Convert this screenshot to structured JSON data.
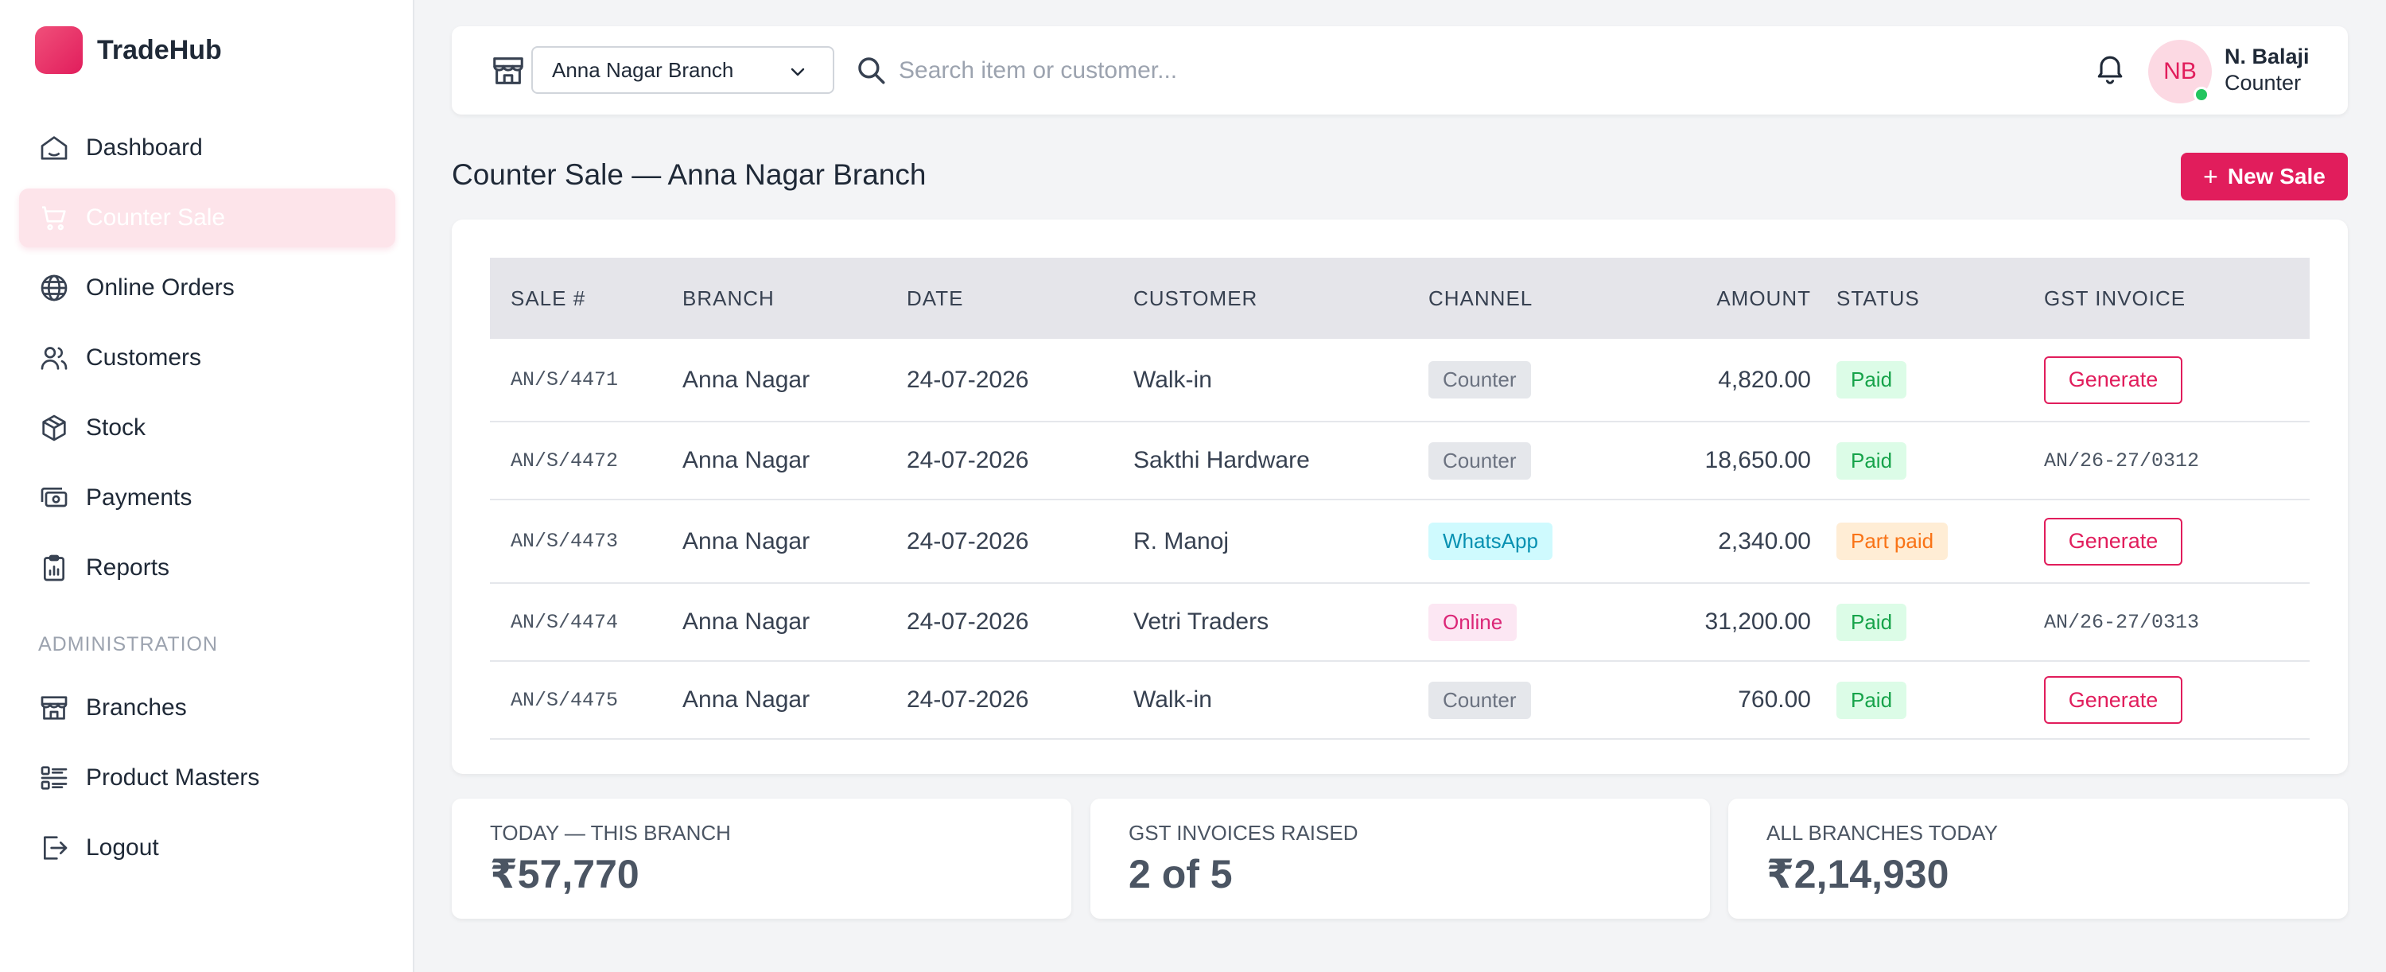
{
  "app": {
    "name": "TradeHub"
  },
  "sidebar": {
    "items": [
      {
        "label": "Dashboard",
        "icon": "home-icon"
      },
      {
        "label": "Counter Sale",
        "icon": "cart-icon",
        "active": true
      },
      {
        "label": "Online Orders",
        "icon": "globe-icon"
      },
      {
        "label": "Customers",
        "icon": "users-icon"
      },
      {
        "label": "Stock",
        "icon": "box-icon"
      },
      {
        "label": "Payments",
        "icon": "cash-icon"
      },
      {
        "label": "Reports",
        "icon": "clipboard-chart-icon"
      }
    ],
    "section_label": "ADMINISTRATION",
    "admin_items": [
      {
        "label": "Branches",
        "icon": "store-icon"
      },
      {
        "label": "Product Masters",
        "icon": "list-icon"
      },
      {
        "label": "Logout",
        "icon": "logout-icon"
      }
    ]
  },
  "topbar": {
    "branch_select": "Anna Nagar Branch",
    "search_placeholder": "Search item or customer...",
    "user": {
      "initials": "NB",
      "name": "N. Balaji",
      "role": "Counter"
    }
  },
  "page": {
    "title": "Counter Sale — Anna Nagar Branch",
    "new_sale_label": "New Sale"
  },
  "table": {
    "columns": [
      "SALE #",
      "BRANCH",
      "DATE",
      "CUSTOMER",
      "CHANNEL",
      "AMOUNT",
      "STATUS",
      "GST INVOICE"
    ],
    "rows": [
      {
        "sale": "AN/S/4471",
        "branch": "Anna Nagar",
        "date": "24-07-2026",
        "customer": "Walk-in",
        "channel": "Counter",
        "amount": "4,820.00",
        "status": "Paid",
        "invoice": "Generate"
      },
      {
        "sale": "AN/S/4472",
        "branch": "Anna Nagar",
        "date": "24-07-2026",
        "customer": "Sakthi Hardware",
        "channel": "Counter",
        "amount": "18,650.00",
        "status": "Paid",
        "invoice": "AN/26-27/0312"
      },
      {
        "sale": "AN/S/4473",
        "branch": "Anna Nagar",
        "date": "24-07-2026",
        "customer": "R. Manoj",
        "channel": "WhatsApp",
        "amount": "2,340.00",
        "status": "Part paid",
        "invoice": "Generate"
      },
      {
        "sale": "AN/S/4474",
        "branch": "Anna Nagar",
        "date": "24-07-2026",
        "customer": "Vetri Traders",
        "channel": "Online",
        "amount": "31,200.00",
        "status": "Paid",
        "invoice": "AN/26-27/0313"
      },
      {
        "sale": "AN/S/4475",
        "branch": "Anna Nagar",
        "date": "24-07-2026",
        "customer": "Walk-in",
        "channel": "Counter",
        "amount": "760.00",
        "status": "Paid",
        "invoice": "Generate"
      }
    ]
  },
  "stats": [
    {
      "label": "TODAY — THIS BRANCH",
      "value": "₹57,770"
    },
    {
      "label": "GST INVOICES RAISED",
      "value": "2 of 5"
    },
    {
      "label": "ALL BRANCHES TODAY",
      "value": "₹2,14,930"
    }
  ],
  "colors": {
    "accent": "#e11d5c",
    "active_bg": "#fde4ea",
    "status_online": "#22c55e"
  }
}
